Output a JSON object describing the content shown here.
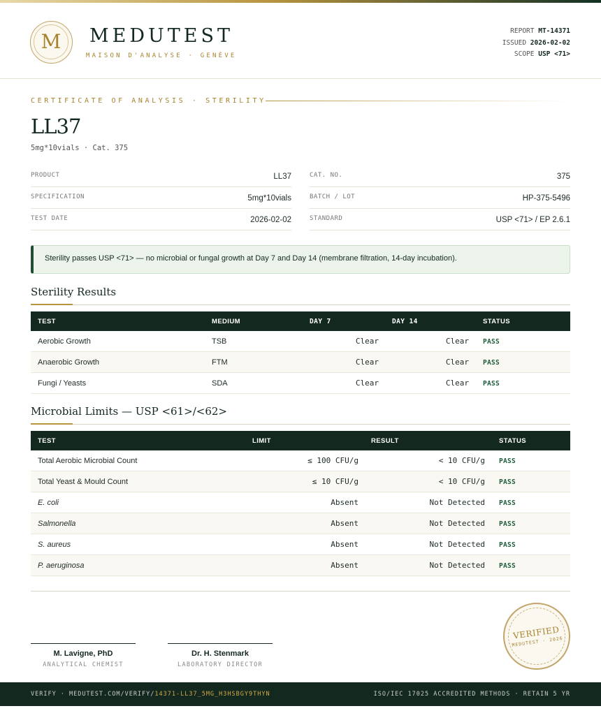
{
  "header": {
    "logo_letter": "M",
    "brand": "MEDUTEST",
    "brand_sub": "MAISON D'ANALYSE · GENÈVE",
    "meta": [
      {
        "label": "REPORT",
        "value": "MT-14371"
      },
      {
        "label": "ISSUED",
        "value": "2026-02-02"
      },
      {
        "label": "SCOPE",
        "value": "USP <71>"
      }
    ]
  },
  "certificate": {
    "label": "CERTIFICATE OF ANALYSIS · STERILITY",
    "title": "LL37",
    "subtitle": "5mg*10vials  ·  Cat. 375"
  },
  "details": {
    "left": [
      {
        "label": "PRODUCT",
        "value": "LL37"
      },
      {
        "label": "SPECIFICATION",
        "value": "5mg*10vials"
      },
      {
        "label": "TEST DATE",
        "value": "2026-02-02"
      }
    ],
    "right": [
      {
        "label": "CAT. NO.",
        "value": "375"
      },
      {
        "label": "BATCH / LOT",
        "value": "HP-375-5496"
      },
      {
        "label": "STANDARD",
        "value": "USP <71> / EP 2.6.1"
      }
    ]
  },
  "banner": {
    "text": "Sterility passes USP <71> — no microbial or fungal growth at Day 7 and Day 14 (membrane filtration, 14-day incubation)."
  },
  "sterility": {
    "title": "Sterility Results",
    "headers": [
      "TEST",
      "MEDIUM",
      "DAY 7",
      "DAY 14",
      "STATUS"
    ],
    "rows": [
      {
        "test": "Aerobic Growth",
        "medium": "TSB",
        "day7": "Clear",
        "day14": "Clear",
        "status": "PASS"
      },
      {
        "test": "Anaerobic Growth",
        "medium": "FTM",
        "day7": "Clear",
        "day14": "Clear",
        "status": "PASS"
      },
      {
        "test": "Fungi / Yeasts",
        "medium": "SDA",
        "day7": "Clear",
        "day14": "Clear",
        "status": "PASS"
      }
    ]
  },
  "microbial": {
    "title": "Microbial Limits — USP <61>/<62>",
    "headers": [
      "TEST",
      "LIMIT",
      "RESULT",
      "STATUS"
    ],
    "rows": [
      {
        "test": "Total Aerobic Microbial Count",
        "limit": "≤ 100 CFU/g",
        "result": "< 10 CFU/g",
        "status": "PASS",
        "italic": false
      },
      {
        "test": "Total Yeast & Mould Count",
        "limit": "≤ 10 CFU/g",
        "result": "< 10 CFU/g",
        "status": "PASS",
        "italic": false
      },
      {
        "test": "E. coli",
        "limit": "Absent",
        "result": "Not Detected",
        "status": "PASS",
        "italic": true
      },
      {
        "test": "Salmonella",
        "limit": "Absent",
        "result": "Not Detected",
        "status": "PASS",
        "italic": true
      },
      {
        "test": "S. aureus",
        "limit": "Absent",
        "result": "Not Detected",
        "status": "PASS",
        "italic": true
      },
      {
        "test": "P. aeruginosa",
        "limit": "Absent",
        "result": "Not Detected",
        "status": "PASS",
        "italic": true
      }
    ]
  },
  "signatures": [
    {
      "name": "M. Lavigne, PhD",
      "role": "ANALYTICAL CHEMIST"
    },
    {
      "name": "Dr. H. Stenmark",
      "role": "LABORATORY DIRECTOR"
    }
  ],
  "seal": {
    "main": "VERIFIED",
    "sub": "MEDUTEST · 2026"
  },
  "footer": {
    "verify_prefix": "VERIFY · MEDUTEST.COM/VERIFY/",
    "verify_code": "14371-LL37_5MG_H3HSBGY9THYN",
    "right": "ISO/IEC 17025 ACCREDITED METHODS · RETAIN 5 YR"
  },
  "colors": {
    "primary": "#13281f",
    "accent": "#b8943f",
    "pass": "#1f5c3c",
    "banner_bg": "#ebf3eb"
  }
}
